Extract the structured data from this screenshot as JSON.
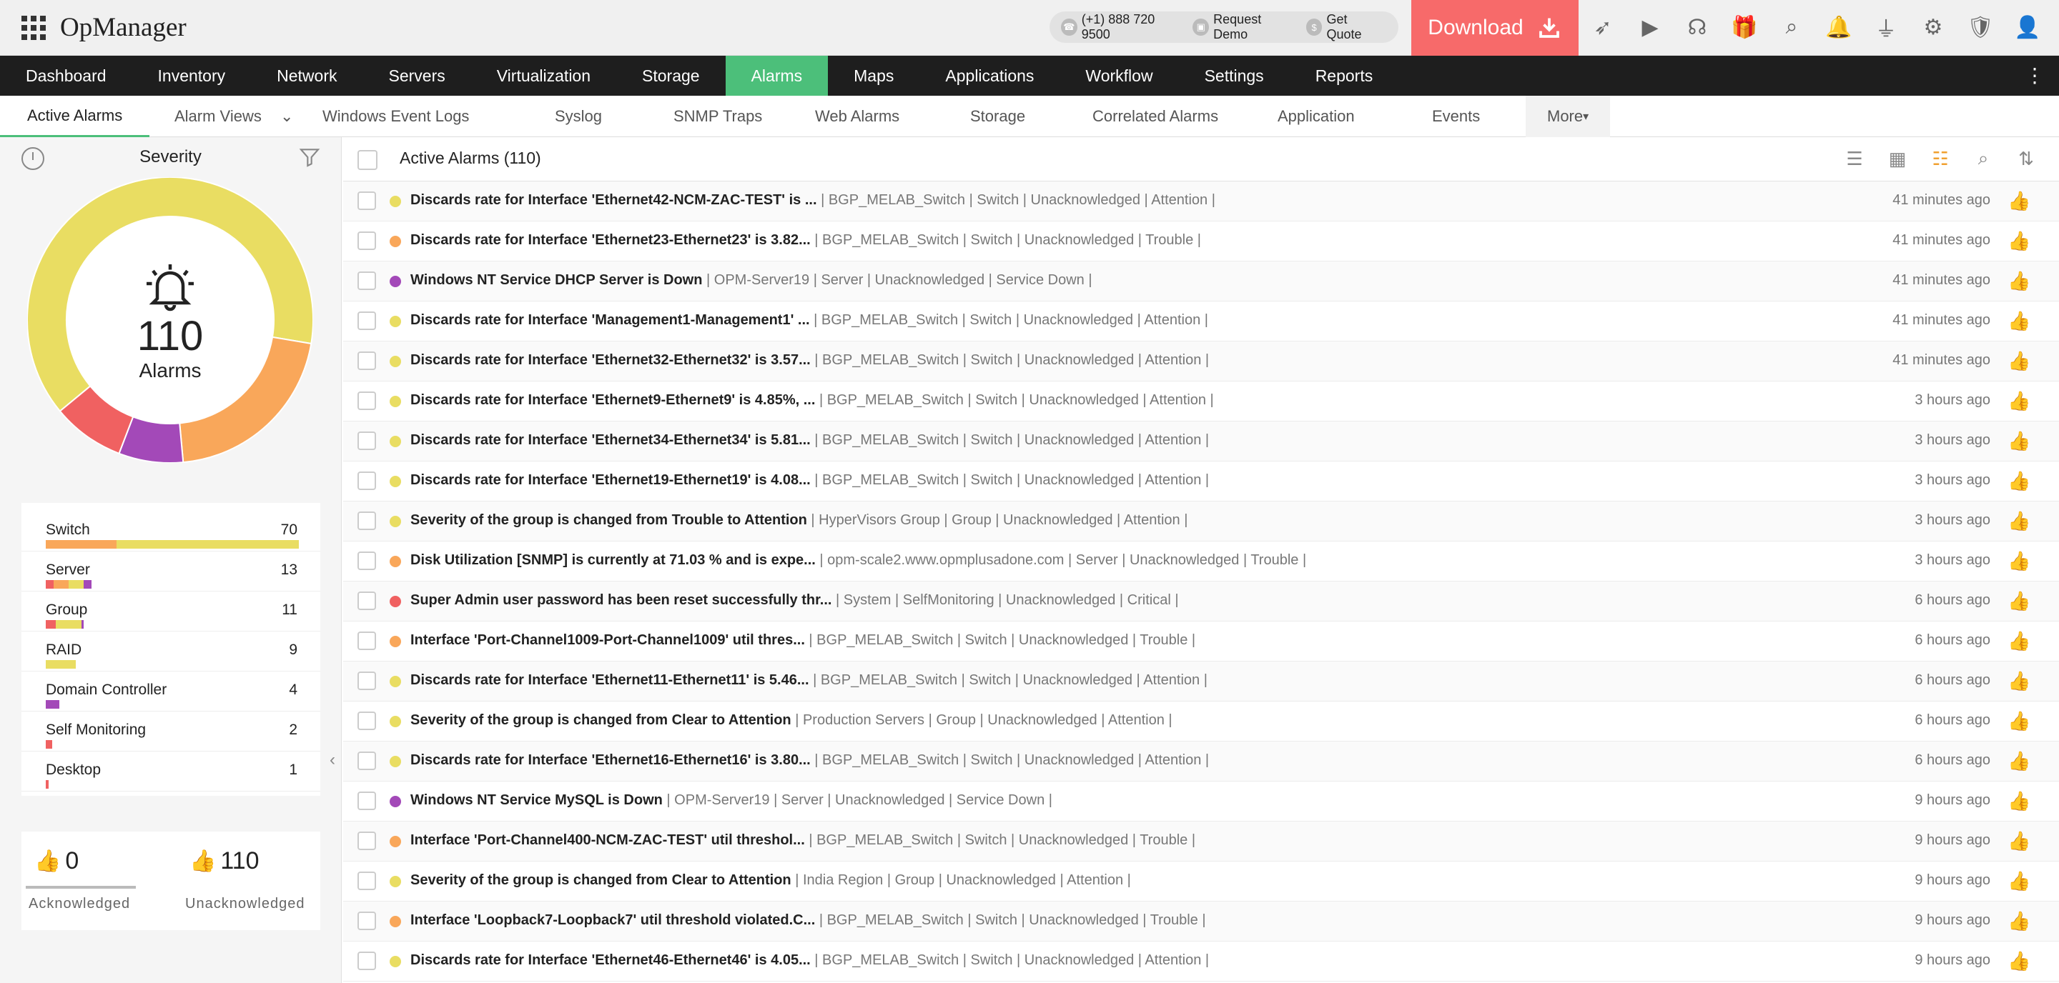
{
  "app": {
    "title": "OpManager"
  },
  "contact": {
    "phone": "(+1) 888 720 9500",
    "demo": "Request Demo",
    "quote": "Get Quote"
  },
  "download": {
    "label": "Download"
  },
  "nav": [
    "Dashboard",
    "Inventory",
    "Network",
    "Servers",
    "Virtualization",
    "Storage",
    "Alarms",
    "Maps",
    "Applications",
    "Workflow",
    "Settings",
    "Reports"
  ],
  "nav_active": "Alarms",
  "subnav": {
    "items": [
      "Active Alarms",
      "Alarm Views",
      "Windows Event Logs",
      "Syslog",
      "SNMP Traps",
      "Web Alarms",
      "Storage",
      "Correlated Alarms",
      "Application",
      "Events"
    ],
    "more": "More"
  },
  "severity": {
    "title": "Severity",
    "total": "110",
    "total_label": "Alarms",
    "slices": [
      {
        "name": "attention",
        "color": "#e9dd62",
        "value": 70
      },
      {
        "name": "trouble",
        "color": "#f9a75a",
        "value": 23
      },
      {
        "name": "service-down",
        "color": "#a349b8",
        "value": 8
      },
      {
        "name": "critical",
        "color": "#f06161",
        "value": 9
      }
    ]
  },
  "categories": [
    {
      "name": "Switch",
      "count": "70",
      "segments": [
        {
          "color": "#f9a75a",
          "frac": 0.28
        },
        {
          "color": "#e9dd62",
          "frac": 0.72
        }
      ]
    },
    {
      "name": "Server",
      "count": "13",
      "segments": [
        {
          "color": "#f06161",
          "frac": 0.03
        },
        {
          "color": "#f9a75a",
          "frac": 0.06
        },
        {
          "color": "#e9dd62",
          "frac": 0.06
        },
        {
          "color": "#a349b8",
          "frac": 0.03
        }
      ]
    },
    {
      "name": "Group",
      "count": "11",
      "segments": [
        {
          "color": "#f06161",
          "frac": 0.04
        },
        {
          "color": "#e9dd62",
          "frac": 0.1
        },
        {
          "color": "#a349b8",
          "frac": 0.01
        }
      ]
    },
    {
      "name": "RAID",
      "count": "9",
      "segments": [
        {
          "color": "#e9dd62",
          "frac": 0.12
        }
      ]
    },
    {
      "name": "Domain Controller",
      "count": "4",
      "segments": [
        {
          "color": "#a349b8",
          "frac": 0.055
        }
      ]
    },
    {
      "name": "Self Monitoring",
      "count": "2",
      "segments": [
        {
          "color": "#f06161",
          "frac": 0.025
        }
      ]
    },
    {
      "name": "Desktop",
      "count": "1",
      "segments": [
        {
          "color": "#f06161",
          "frac": 0.012
        }
      ]
    }
  ],
  "ack": {
    "ack_count": "0",
    "ack_label": "Acknowledged",
    "unack_count": "110",
    "unack_label": "Unacknowledged"
  },
  "alarms_header": {
    "title": "Active Alarms (110)"
  },
  "alarms": [
    {
      "color": "#e9dd62",
      "msg": "Discards rate for Interface 'Ethernet42-NCM-ZAC-TEST' is ...",
      "meta": " | BGP_MELAB_Switch | Switch | Unacknowledged | Attention |",
      "time": "41 minutes ago"
    },
    {
      "color": "#f9a75a",
      "msg": "Discards rate for Interface 'Ethernet23-Ethernet23' is 3.82...",
      "meta": " | BGP_MELAB_Switch | Switch | Unacknowledged | Trouble |",
      "time": "41 minutes ago"
    },
    {
      "color": "#a349b8",
      "msg": "Windows NT Service DHCP Server is Down",
      "meta": " | OPM-Server19 | Server | Unacknowledged | Service Down |",
      "time": "41 minutes ago"
    },
    {
      "color": "#e9dd62",
      "msg": "Discards rate for Interface 'Management1-Management1' ...",
      "meta": " | BGP_MELAB_Switch | Switch | Unacknowledged | Attention |",
      "time": "41 minutes ago"
    },
    {
      "color": "#e9dd62",
      "msg": "Discards rate for Interface 'Ethernet32-Ethernet32' is 3.57...",
      "meta": " | BGP_MELAB_Switch | Switch | Unacknowledged | Attention |",
      "time": "41 minutes ago"
    },
    {
      "color": "#e9dd62",
      "msg": "Discards rate for Interface 'Ethernet9-Ethernet9' is 4.85%, ...",
      "meta": " | BGP_MELAB_Switch | Switch | Unacknowledged | Attention |",
      "time": "3 hours ago"
    },
    {
      "color": "#e9dd62",
      "msg": "Discards rate for Interface 'Ethernet34-Ethernet34' is 5.81...",
      "meta": " | BGP_MELAB_Switch | Switch | Unacknowledged | Attention |",
      "time": "3 hours ago"
    },
    {
      "color": "#e9dd62",
      "msg": "Discards rate for Interface 'Ethernet19-Ethernet19' is 4.08...",
      "meta": " | BGP_MELAB_Switch | Switch | Unacknowledged | Attention |",
      "time": "3 hours ago"
    },
    {
      "color": "#e9dd62",
      "msg": "Severity of the group is changed from Trouble to Attention",
      "meta": " | HyperVisors Group | Group | Unacknowledged | Attention |",
      "time": "3 hours ago"
    },
    {
      "color": "#f9a75a",
      "msg": "Disk Utilization [SNMP] is currently at 71.03 % and is expe...",
      "meta": " | opm-scale2.www.opmplusadone.com | Server | Unacknowledged | Trouble |",
      "time": "3 hours ago"
    },
    {
      "color": "#f06161",
      "msg": "Super Admin user password has been reset successfully thr...",
      "meta": " | System | SelfMonitoring | Unacknowledged | Critical |",
      "time": "6 hours ago"
    },
    {
      "color": "#f9a75a",
      "msg": "Interface 'Port-Channel1009-Port-Channel1009' util thres...",
      "meta": " | BGP_MELAB_Switch | Switch | Unacknowledged | Trouble |",
      "time": "6 hours ago"
    },
    {
      "color": "#e9dd62",
      "msg": "Discards rate for Interface 'Ethernet11-Ethernet11' is 5.46...",
      "meta": " | BGP_MELAB_Switch | Switch | Unacknowledged | Attention |",
      "time": "6 hours ago"
    },
    {
      "color": "#e9dd62",
      "msg": "Severity of the group is changed from Clear to Attention",
      "meta": " | Production Servers | Group | Unacknowledged | Attention |",
      "time": "6 hours ago"
    },
    {
      "color": "#e9dd62",
      "msg": "Discards rate for Interface 'Ethernet16-Ethernet16' is 3.80...",
      "meta": " | BGP_MELAB_Switch | Switch | Unacknowledged | Attention |",
      "time": "6 hours ago"
    },
    {
      "color": "#a349b8",
      "msg": "Windows NT Service MySQL is Down",
      "meta": " | OPM-Server19 | Server | Unacknowledged | Service Down |",
      "time": "9 hours ago"
    },
    {
      "color": "#f9a75a",
      "msg": "Interface 'Port-Channel400-NCM-ZAC-TEST' util threshol...",
      "meta": " | BGP_MELAB_Switch | Switch | Unacknowledged | Trouble |",
      "time": "9 hours ago"
    },
    {
      "color": "#e9dd62",
      "msg": "Severity of the group is changed from Clear to Attention",
      "meta": " | India Region | Group | Unacknowledged | Attention |",
      "time": "9 hours ago"
    },
    {
      "color": "#f9a75a",
      "msg": "Interface 'Loopback7-Loopback7' util threshold violated.C...",
      "meta": " | BGP_MELAB_Switch | Switch | Unacknowledged | Trouble |",
      "time": "9 hours ago"
    },
    {
      "color": "#e9dd62",
      "msg": "Discards rate for Interface 'Ethernet46-Ethernet46' is 4.05...",
      "meta": " | BGP_MELAB_Switch | Switch | Unacknowledged | Attention |",
      "time": "9 hours ago"
    }
  ]
}
